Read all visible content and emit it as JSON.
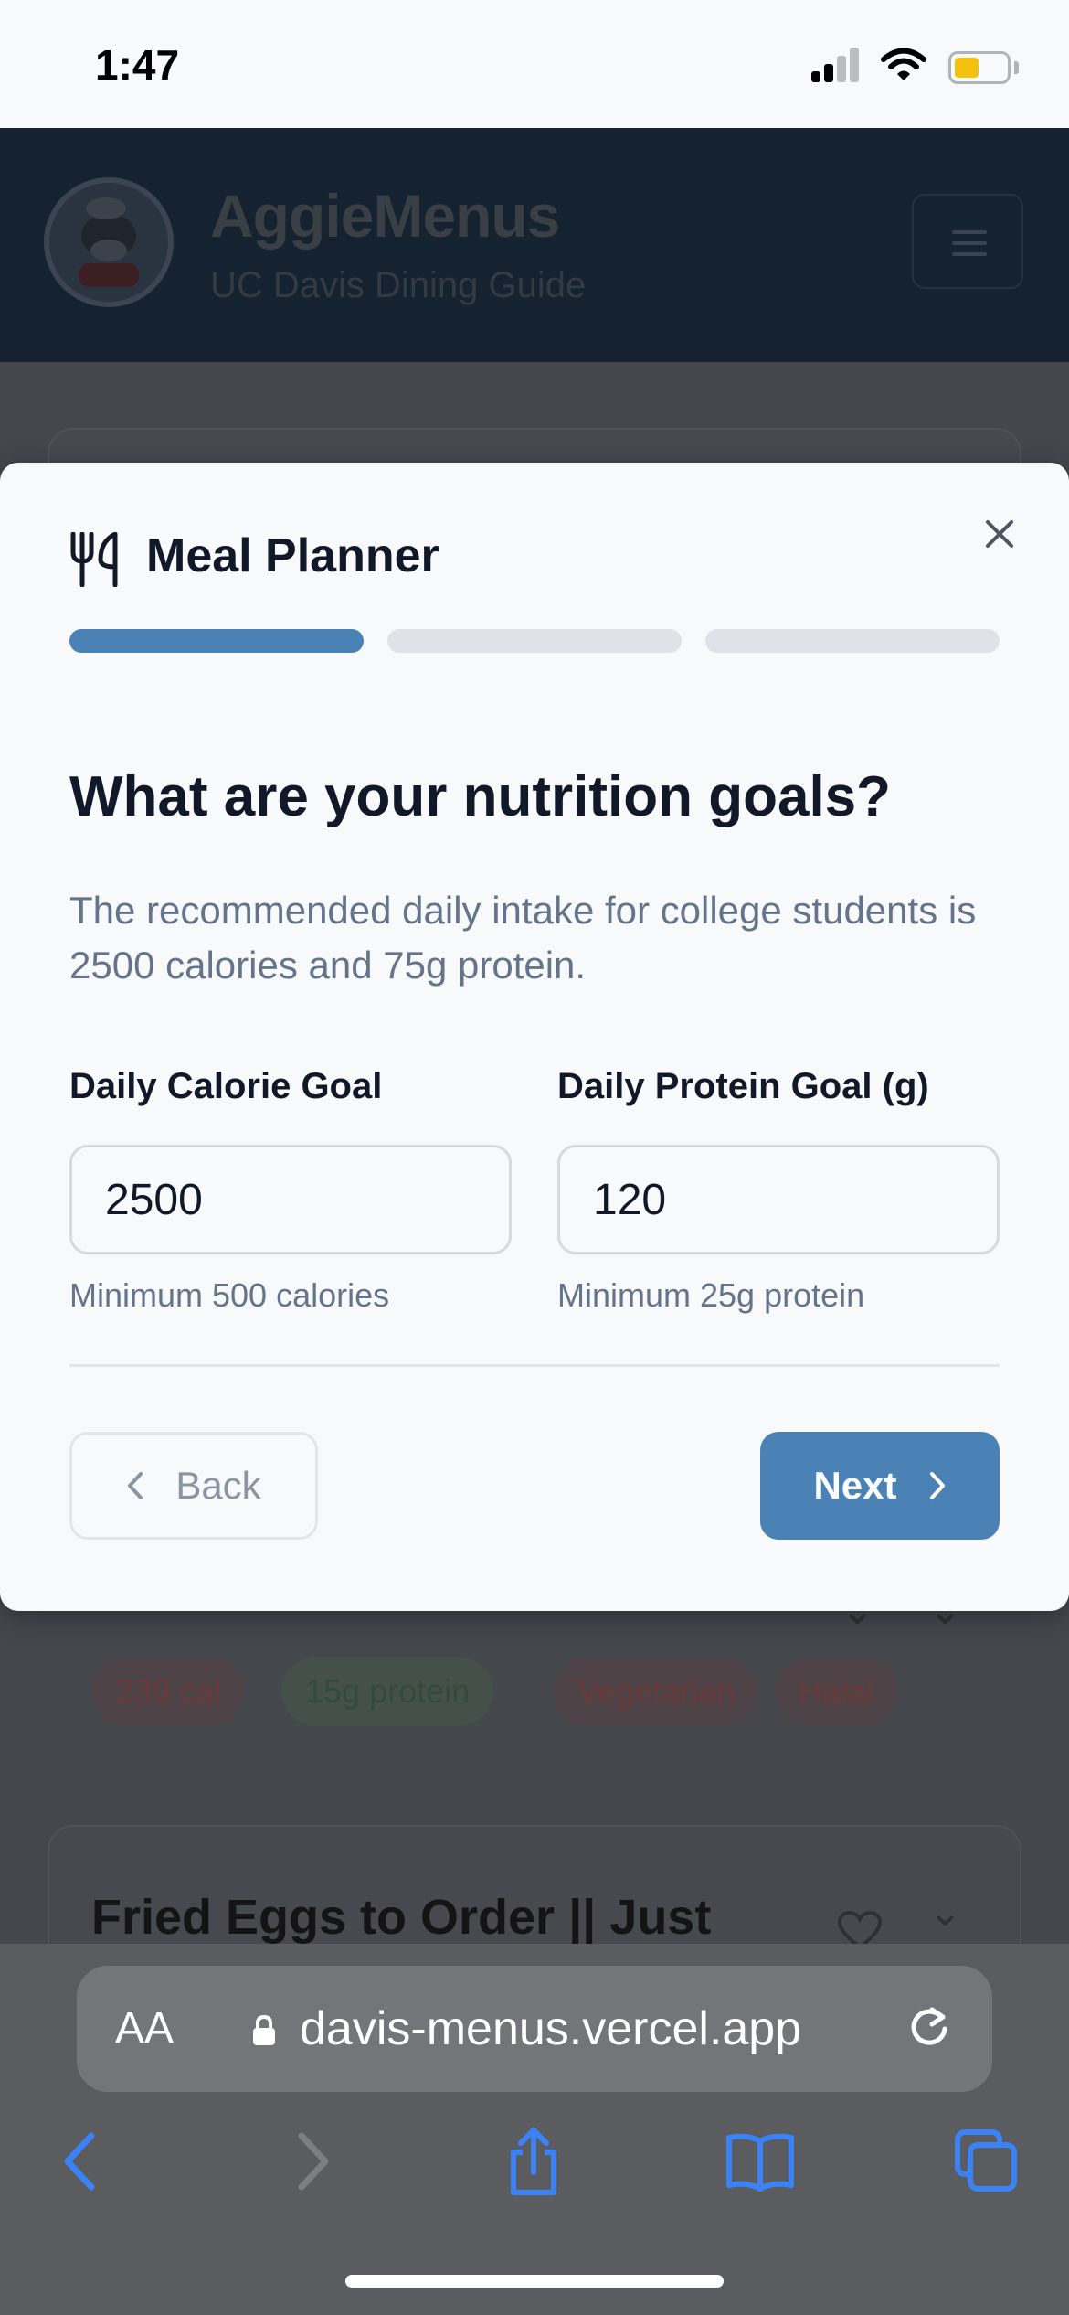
{
  "status_bar": {
    "time": "1:47",
    "icons": [
      "cellular-signal-icon",
      "wifi-icon",
      "battery-icon"
    ],
    "battery_color": "#f4c20d"
  },
  "background_page": {
    "brand_title": "AggieMenus",
    "brand_subtitle": "UC Davis Dining Guide",
    "tags": [
      "239 cal",
      "15g protein",
      "Vegetarian",
      "Halal"
    ],
    "food_title": "Fried Eggs to Order || Just"
  },
  "modal": {
    "title": "Meal Planner",
    "title_icon": "utensils-icon",
    "close_icon": "close-icon",
    "progress": {
      "total_steps": 3,
      "current_step": 1
    },
    "question": "What are your nutrition goals?",
    "description": "The recommended daily intake for college students is 2500 calories and 75g protein.",
    "calorie": {
      "label": "Daily Calorie Goal",
      "value": "2500",
      "hint": "Minimum 500 calories"
    },
    "protein": {
      "label": "Daily Protein Goal (g)",
      "value": "120",
      "hint": "Minimum 25g protein"
    },
    "back_label": "Back",
    "next_label": "Next",
    "accent_color": "#4a82b6"
  },
  "browser": {
    "aa_label": "AA",
    "url": "davis-menus.vercel.app",
    "toolbar": [
      "back-icon",
      "forward-icon",
      "share-icon",
      "bookmarks-icon",
      "tabs-icon"
    ],
    "accent_color": "#3b82f6"
  }
}
